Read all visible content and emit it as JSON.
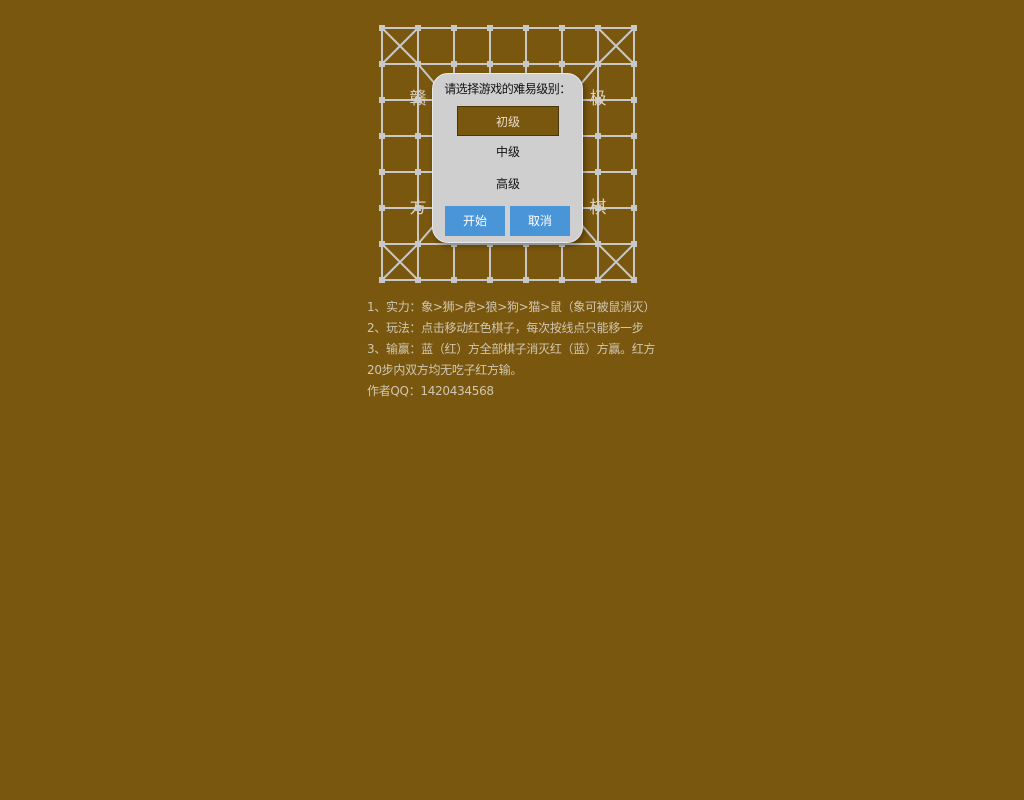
{
  "board": {
    "corner_chars": [
      "赣",
      "极",
      "方",
      "棋"
    ],
    "line_color": "#c8c8c8",
    "background_color": "#7a570e"
  },
  "dialog": {
    "title": "请选择游戏的难易级别：",
    "levels": [
      "初级",
      "中级",
      "高级"
    ],
    "selected_level": "初级",
    "start_label": "开始",
    "cancel_label": "取消",
    "button_color": "#4a95d8"
  },
  "rules": {
    "line1": "1、实力：象>狮>虎>狼>狗>猫>鼠（象可被鼠消灭）",
    "line2": "2、玩法：点击移动红色棋子，每次按线点只能移一步",
    "line3": "3、输赢：蓝（红）方全部棋子消灭红（蓝）方赢。红方20步内双方均无吃子红方输。",
    "author": "作者QQ：1420434568"
  }
}
